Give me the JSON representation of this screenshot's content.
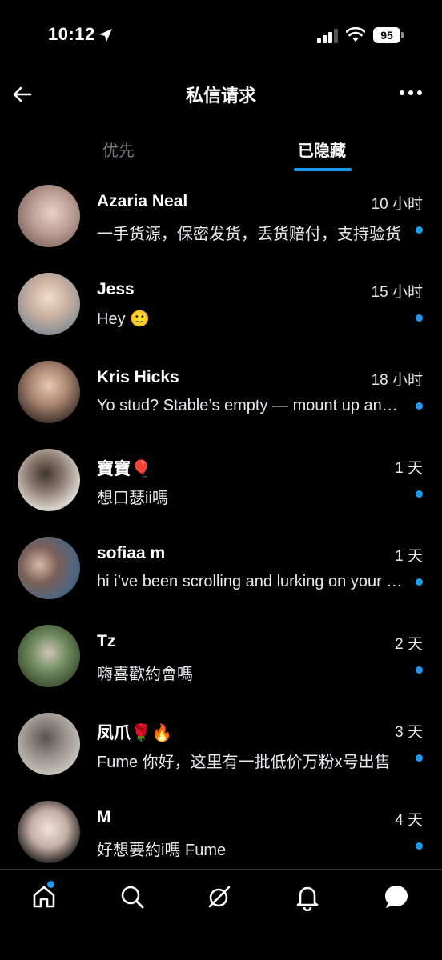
{
  "status_bar": {
    "time": "10:12",
    "battery": "95"
  },
  "header": {
    "title": "私信请求"
  },
  "tabs": [
    {
      "label": "优先",
      "active": false
    },
    {
      "label": "已隐藏",
      "active": true
    }
  ],
  "conversations": [
    {
      "name": "Azaria Neal",
      "time": "10 小时",
      "preview": "一手货源，保密发货，丢货赔付，支持验货",
      "unread": true
    },
    {
      "name": "Jess",
      "time": "15 小时",
      "preview": "Hey 🙂",
      "unread": true
    },
    {
      "name": "Kris Hicks",
      "time": "18 小时",
      "preview": "Yo stud? Stable’s empty — mount up and ride",
      "unread": true
    },
    {
      "name": "寶寶🎈",
      "time": "1 天",
      "preview": "想口瑟ii嗎",
      "unread": true
    },
    {
      "name": "sofiaa m",
      "time": "1 天",
      "preview": "hi i’ve been scrolling and lurking on your page",
      "unread": true
    },
    {
      "name": "Tz",
      "time": "2 天",
      "preview": "嗨喜歡約會嗎",
      "unread": true
    },
    {
      "name": "凤爪🌹🔥",
      "time": "3 天",
      "preview": "Fume 你好，这里有一批低价万粉x号出售",
      "unread": true
    },
    {
      "name": "M",
      "time": "4 天",
      "preview": "好想要約i嗎 Fume",
      "unread": true
    }
  ],
  "bottom_nav": [
    {
      "icon": "home-icon",
      "badge": true
    },
    {
      "icon": "search-icon",
      "badge": false
    },
    {
      "icon": "grok-icon",
      "badge": false
    },
    {
      "icon": "bell-icon",
      "badge": false
    },
    {
      "icon": "messages-icon",
      "badge": false
    }
  ],
  "colors": {
    "accent": "#1d9bf0",
    "background": "#000000",
    "muted": "#71767b"
  }
}
